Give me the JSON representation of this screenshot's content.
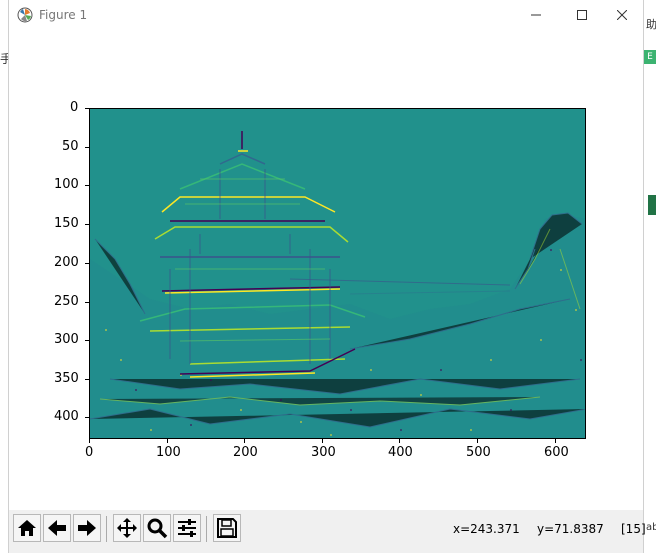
{
  "window": {
    "title": "Figure 1"
  },
  "background_app": {
    "left_fragment": "手",
    "right_text_1": "助",
    "right_text_2": "ab",
    "right_badge": "E"
  },
  "plot": {
    "y_ticks": [
      "0",
      "50",
      "100",
      "150",
      "200",
      "250",
      "300",
      "350",
      "400"
    ],
    "x_ticks": [
      "0",
      "100",
      "200",
      "300",
      "400",
      "500",
      "600"
    ],
    "x_range": [
      0,
      640
    ],
    "y_range": [
      0,
      427
    ],
    "colormap": "viridis",
    "image": "edge-filtered image of a pagoda"
  },
  "toolbar": {
    "buttons": [
      "home-icon",
      "back-icon",
      "forward-icon",
      "pan-icon",
      "zoom-icon",
      "configure-subplots-icon",
      "save-icon"
    ]
  },
  "status": {
    "x": "x=243.371",
    "y": "y=71.8387",
    "value": "[15]"
  }
}
